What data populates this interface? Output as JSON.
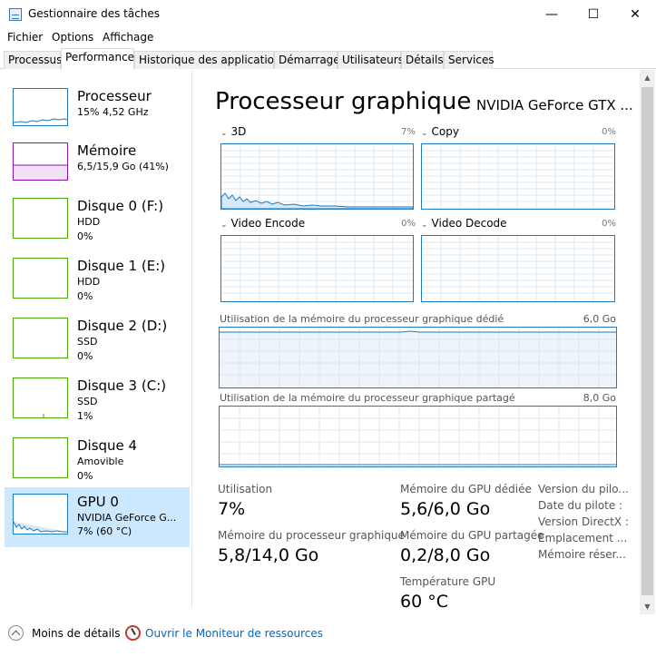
{
  "window": {
    "title": "Gestionnaire des tâches",
    "minimize_glyph": "—",
    "maximize_glyph": "☐",
    "close_glyph": "✕"
  },
  "menu": [
    "Fichier",
    "Options",
    "Affichage"
  ],
  "tabs": [
    {
      "label": "Processus",
      "active": false
    },
    {
      "label": "Performance",
      "active": true
    },
    {
      "label": "Historique des applications",
      "active": false
    },
    {
      "label": "Démarrage",
      "active": false
    },
    {
      "label": "Utilisateurs",
      "active": false
    },
    {
      "label": "Détails",
      "active": false
    },
    {
      "label": "Services",
      "active": false
    }
  ],
  "devices": [
    {
      "name": "Processeur",
      "sub1": "15% 4,52 GHz",
      "sub2": "",
      "color": "#1f7ac2"
    },
    {
      "name": "Mémoire",
      "sub1": "6,5/15,9 Go (41%)",
      "sub2": "",
      "color": "#8b12ae"
    },
    {
      "name": "Disque 0 (F:)",
      "sub1": "HDD",
      "sub2": "0%",
      "color": "#4da60c"
    },
    {
      "name": "Disque 1 (E:)",
      "sub1": "HDD",
      "sub2": "0%",
      "color": "#4da60c"
    },
    {
      "name": "Disque 2 (D:)",
      "sub1": "SSD",
      "sub2": "0%",
      "color": "#4da60c"
    },
    {
      "name": "Disque 3 (C:)",
      "sub1": "SSD",
      "sub2": "1%",
      "color": "#4da60c"
    },
    {
      "name": "Disque 4",
      "sub1": "Amovible",
      "sub2": "0%",
      "color": "#4da60c"
    },
    {
      "name": "GPU 0",
      "sub1": "NVIDIA GeForce G...",
      "sub2": "7% (60 °C)",
      "color": "#1f7ac2",
      "selected": true
    }
  ],
  "main": {
    "title": "Processeur graphique",
    "gpu_model": "NVIDIA GeForce GTX ...",
    "engines": [
      {
        "label": "3D",
        "percent": "7%"
      },
      {
        "label": "Copy",
        "percent": "0%"
      },
      {
        "label": "Video Encode",
        "percent": "0%"
      },
      {
        "label": "Video Decode",
        "percent": "0%"
      }
    ],
    "dedicated_memory": {
      "label": "Utilisation de la mémoire du processeur graphique dédié",
      "max": "6,0 Go"
    },
    "shared_memory": {
      "label": "Utilisation de la mémoire du processeur graphique partagé",
      "max": "8,0 Go"
    }
  },
  "stats": {
    "utilisation_label": "Utilisation",
    "utilisation_value": "7%",
    "gpu_memory_label": "Mémoire du processeur graphique",
    "gpu_memory_value": "5,8/14,0 Go",
    "dedicated_label": "Mémoire du GPU dédiée",
    "dedicated_value": "5,6/6,0 Go",
    "shared_label": "Mémoire du GPU partagée",
    "shared_value": "0,2/8,0 Go",
    "temp_label": "Température GPU",
    "temp_value": "60 °C",
    "side": [
      "Version du pilo...",
      "Date du pilote :",
      "Version DirectX :",
      "Emplacement ...",
      "Mémoire réser..."
    ]
  },
  "footer": {
    "less_details": "Moins de détails",
    "monitor_link": "Ouvrir le Moniteur de ressources"
  }
}
